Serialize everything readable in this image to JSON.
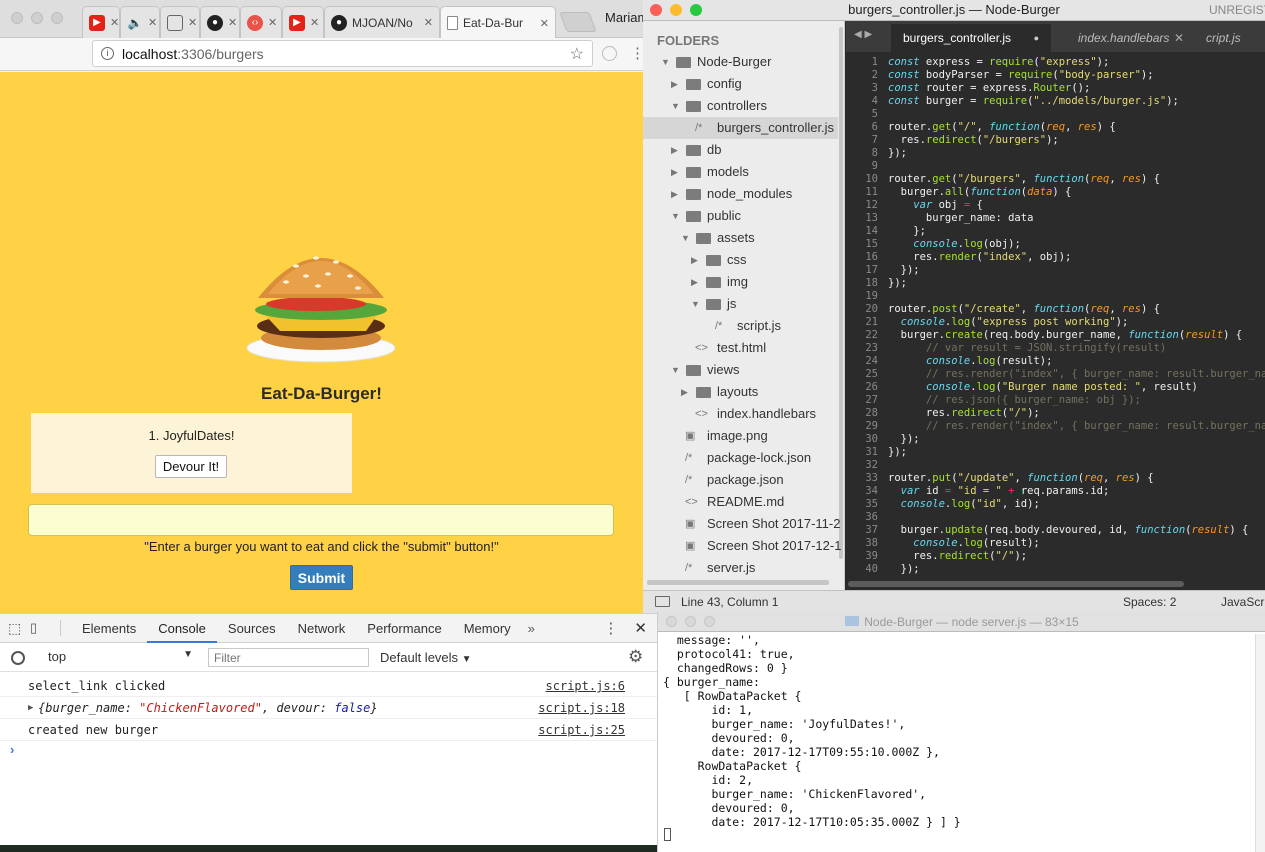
{
  "chrome": {
    "tabs": [
      {
        "label": "",
        "icon": "youtube-icon"
      },
      {
        "label": "",
        "icon": "speaker-icon"
      },
      {
        "label": "",
        "icon": "book-icon"
      },
      {
        "label": "",
        "icon": "github-icon"
      },
      {
        "label": "",
        "icon": "code-icon"
      },
      {
        "label": "",
        "icon": "youtube-icon"
      },
      {
        "label": "MJOAN/No",
        "icon": "github-icon"
      },
      {
        "label": "Eat-Da-Bur",
        "icon": "page-icon"
      }
    ],
    "profile": "Mariam",
    "url_host": "localhost",
    "url_path": ":3306/burgers"
  },
  "page": {
    "title": "Eat-Da-Burger!",
    "item_label": "1. JoyfulDates!",
    "devour_label": "Devour It!",
    "hint": "\"Enter a burger you want to eat and click the \"submit\" button!\"",
    "submit_label": "Submit"
  },
  "devtools": {
    "tabs": [
      "Elements",
      "Console",
      "Sources",
      "Network",
      "Performance",
      "Memory"
    ],
    "context": "top",
    "filter_placeholder": "Filter",
    "levels": "Default levels",
    "console": [
      {
        "msg": "select_link clicked",
        "src": "script.js:6"
      },
      {
        "msg_parts": [
          "{burger_name: ",
          "\"ChickenFlavored\"",
          ", devour: ",
          "false",
          "}"
        ],
        "src": "script.js:18"
      },
      {
        "msg": "created new burger",
        "src": "script.js:25"
      }
    ]
  },
  "sublime": {
    "window_title": "burgers_controller.js — Node-Burger",
    "unregistered": "UNREGISTERED",
    "folders_header": "FOLDERS",
    "tree": [
      {
        "label": "Node-Burger",
        "type": "folder-open",
        "depth": 0
      },
      {
        "label": "config",
        "type": "folder",
        "depth": 1
      },
      {
        "label": "controllers",
        "type": "folder-open",
        "depth": 1
      },
      {
        "label": "burgers_controller.js",
        "type": "js",
        "depth": 2,
        "selected": true
      },
      {
        "label": "db",
        "type": "folder",
        "depth": 1
      },
      {
        "label": "models",
        "type": "folder",
        "depth": 1
      },
      {
        "label": "node_modules",
        "type": "folder",
        "depth": 1
      },
      {
        "label": "public",
        "type": "folder-open",
        "depth": 1
      },
      {
        "label": "assets",
        "type": "folder-open",
        "depth": 2
      },
      {
        "label": "css",
        "type": "folder",
        "depth": 3
      },
      {
        "label": "img",
        "type": "folder",
        "depth": 3
      },
      {
        "label": "js",
        "type": "folder-open",
        "depth": 3
      },
      {
        "label": "script.js",
        "type": "js",
        "depth": 4
      },
      {
        "label": "test.html",
        "type": "html",
        "depth": 2
      },
      {
        "label": "views",
        "type": "folder-open",
        "depth": 1
      },
      {
        "label": "layouts",
        "type": "folder",
        "depth": 2
      },
      {
        "label": "index.handlebars",
        "type": "html",
        "depth": 2
      },
      {
        "label": "image.png",
        "type": "image",
        "depth": 1
      },
      {
        "label": "package-lock.json",
        "type": "js",
        "depth": 1
      },
      {
        "label": "package.json",
        "type": "js",
        "depth": 1
      },
      {
        "label": "README.md",
        "type": "html",
        "depth": 1
      },
      {
        "label": "Screen Shot 2017-11-2",
        "type": "image",
        "depth": 1
      },
      {
        "label": "Screen Shot 2017-12-1",
        "type": "image",
        "depth": 1
      },
      {
        "label": "server.js",
        "type": "js",
        "depth": 1
      }
    ],
    "tabs": [
      {
        "label": "burgers_controller.js",
        "active": true
      },
      {
        "label": "index.handlebars",
        "active": false
      },
      {
        "label": "cript.js",
        "active": false
      }
    ],
    "status_position": "Line 43, Column 1",
    "status_spaces": "Spaces: 2",
    "status_syntax": "JavaScript"
  },
  "terminal": {
    "title": "Node-Burger — node server.js — 83×15",
    "lines": [
      "  message: '',",
      "  protocol41: true,",
      "  changedRows: 0 }",
      "{ burger_name:",
      "   [ RowDataPacket {",
      "       id: 1,",
      "       burger_name: 'JoyfulDates!',",
      "       devoured: 0,",
      "       date: 2017-12-17T09:55:10.000Z },",
      "     RowDataPacket {",
      "       id: 2,",
      "       burger_name: 'ChickenFlavored',",
      "       devoured: 0,",
      "       date: 2017-12-17T10:05:35.000Z } ] }"
    ]
  },
  "colors": {
    "page_bg": "#fed244",
    "submit": "#357ebd",
    "editor_bg": "#2b2b2b"
  }
}
